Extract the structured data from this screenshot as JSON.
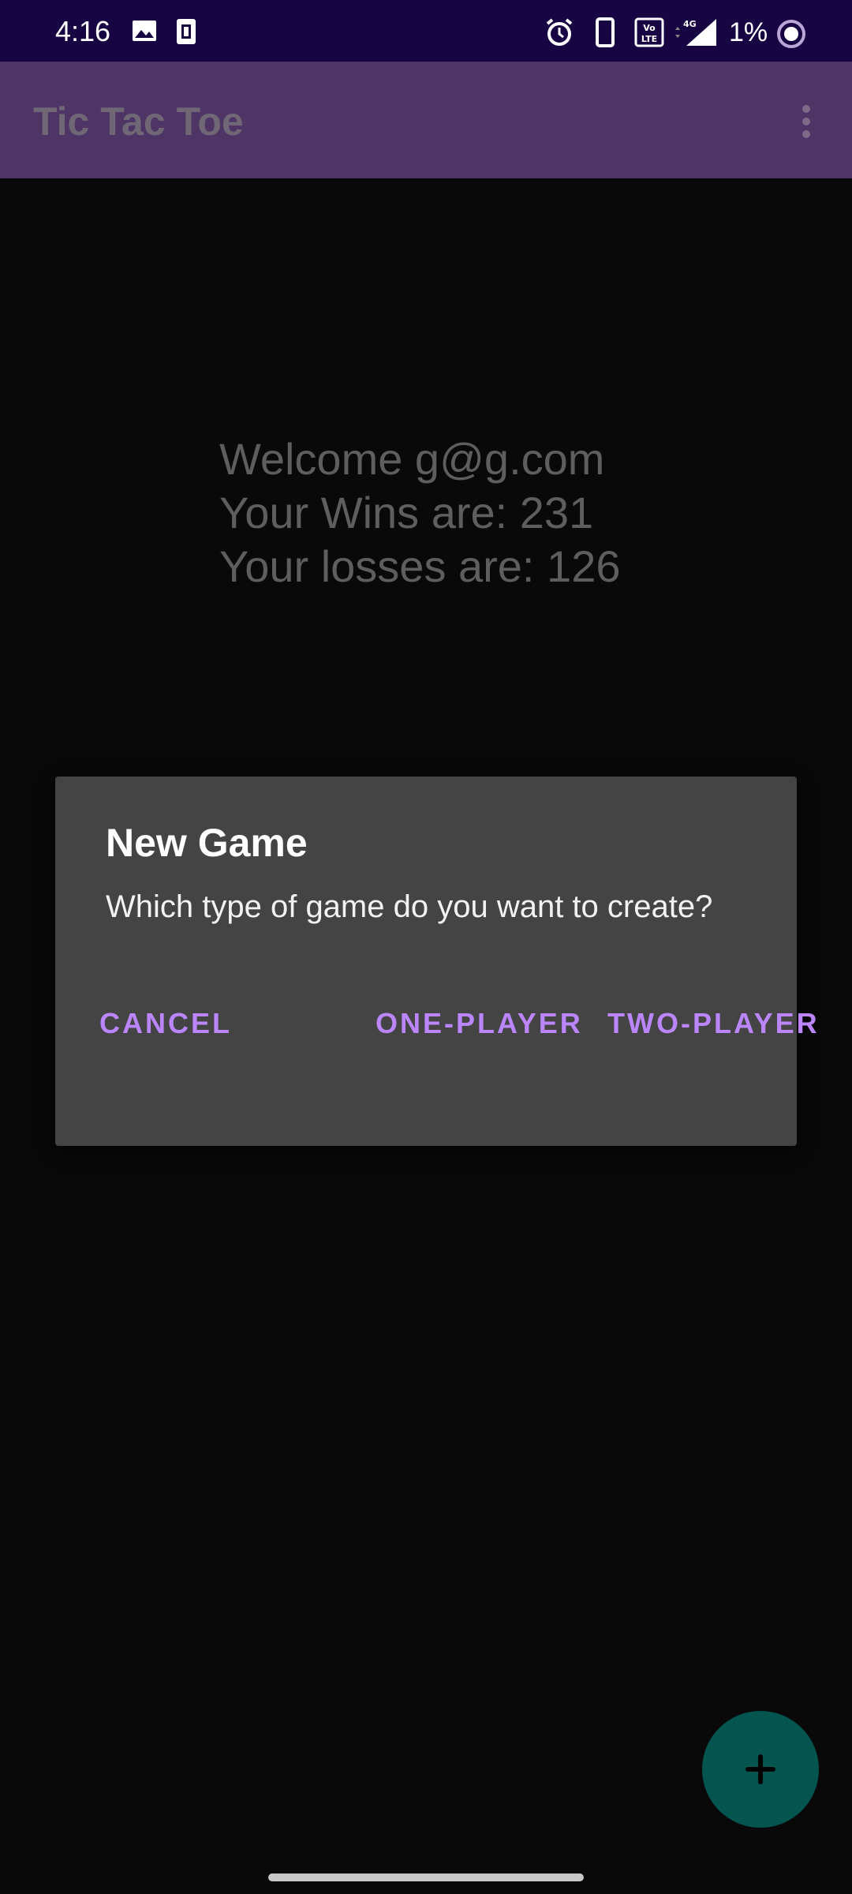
{
  "status_bar": {
    "time": "4:16",
    "battery": "1%",
    "icons": [
      "image-icon",
      "sim-card-icon",
      "alarm-icon",
      "phone-icon",
      "volte-icon",
      "signal-4g-icon",
      "battery-saver-icon"
    ]
  },
  "app_bar": {
    "title": "Tic Tac Toe",
    "menu_icon": "more-vert-icon"
  },
  "welcome": {
    "line1": "Welcome g@g.com",
    "line2": "Your Wins are: 231",
    "line3": "Your losses are: 126"
  },
  "dialog": {
    "title": "New Game",
    "message": "Which type of game do you want to create?",
    "cancel_label": "CANCEL",
    "one_player_label": "ONE-PLAYER",
    "two_player_label": "TWO-PLAYER"
  },
  "fab": {
    "icon": "add-icon"
  },
  "colors": {
    "status_bar": "#170543",
    "app_bar": "#4f3566",
    "dialog_bg": "#444444",
    "accent": "#bb86fc",
    "fab": "#045550"
  }
}
